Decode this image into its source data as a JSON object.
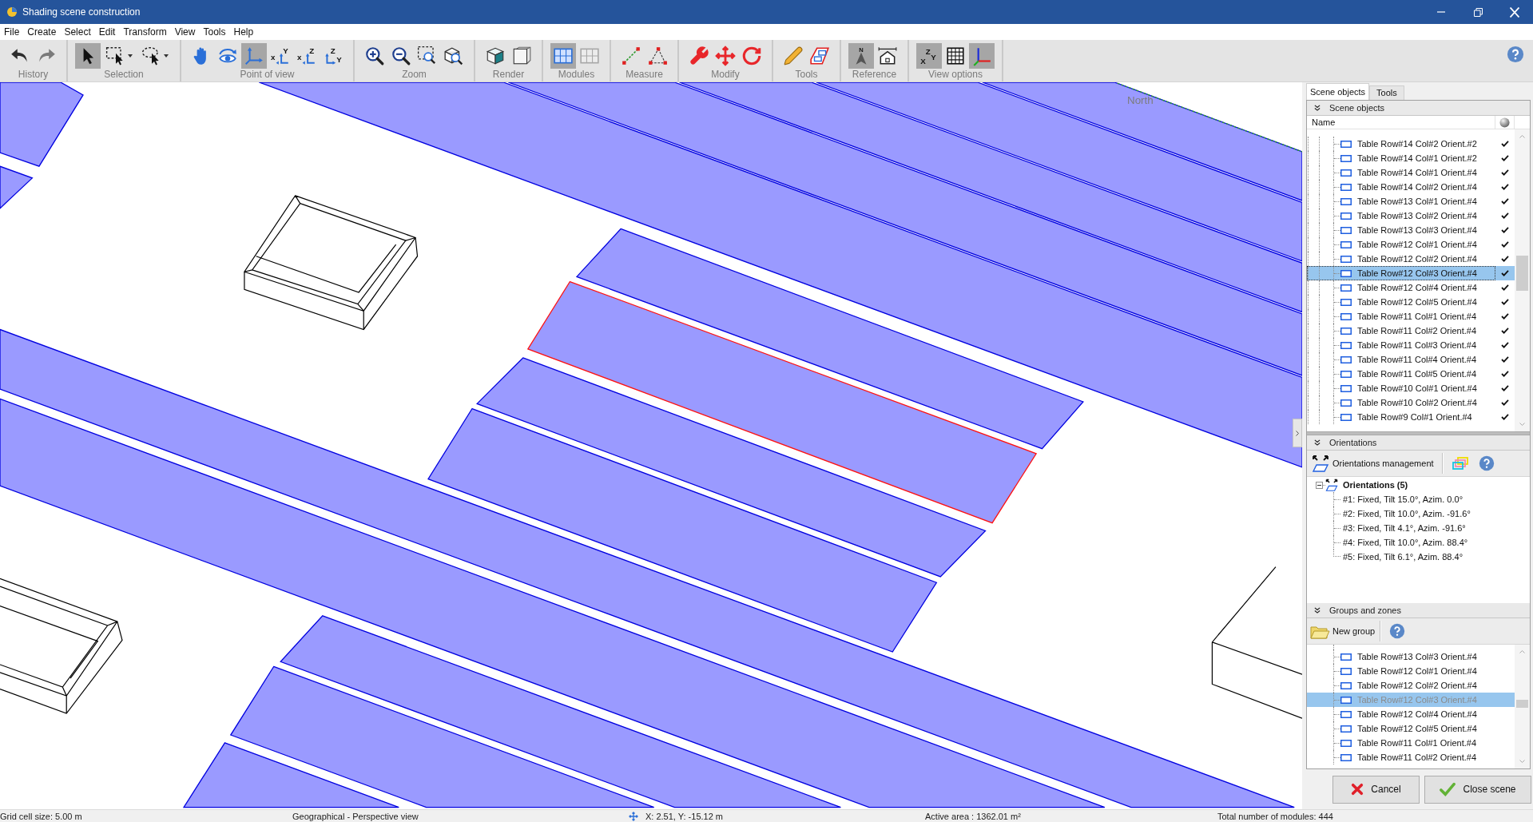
{
  "window": {
    "title": "Shading scene construction"
  },
  "menu": [
    "File",
    "Create",
    "Select",
    "Edit",
    "Transform",
    "View",
    "Tools",
    "Help"
  ],
  "toolbar": {
    "groups": [
      {
        "label": "History",
        "buttons": [
          {
            "kind": "undo",
            "selected": false
          },
          {
            "kind": "redo",
            "selected": false
          }
        ]
      },
      {
        "label": "Selection",
        "buttons": [
          {
            "kind": "pointer",
            "selected": true
          },
          {
            "kind": "rect-select",
            "selected": false,
            "dropdown": true
          },
          {
            "kind": "lasso-select",
            "selected": false,
            "dropdown": true
          }
        ]
      },
      {
        "label": "Point of view",
        "buttons": [
          {
            "kind": "pan",
            "selected": false
          },
          {
            "kind": "orbit",
            "selected": false
          },
          {
            "kind": "axes-view",
            "selected": true
          },
          {
            "kind": "view-xy",
            "selected": false,
            "letters": [
              "x",
              "Y"
            ]
          },
          {
            "kind": "view-xz",
            "selected": false,
            "letters": [
              "x",
              "Z"
            ]
          },
          {
            "kind": "view-zy",
            "selected": false,
            "letters": [
              "Z",
              "Y"
            ]
          }
        ]
      },
      {
        "label": "Zoom",
        "buttons": [
          {
            "kind": "zoom-in",
            "selected": false
          },
          {
            "kind": "zoom-out",
            "selected": false
          },
          {
            "kind": "zoom-window",
            "selected": false
          },
          {
            "kind": "zoom-extents",
            "selected": false
          }
        ]
      },
      {
        "label": "Render",
        "buttons": [
          {
            "kind": "render-solid",
            "selected": false
          },
          {
            "kind": "render-wire",
            "selected": false
          }
        ]
      },
      {
        "label": "Modules",
        "buttons": [
          {
            "kind": "modules-grid",
            "selected": true
          },
          {
            "kind": "modules-table",
            "selected": false
          }
        ]
      },
      {
        "label": "Measure",
        "buttons": [
          {
            "kind": "measure-distance",
            "selected": false
          },
          {
            "kind": "measure-angle",
            "selected": false
          }
        ]
      },
      {
        "label": "Modify",
        "buttons": [
          {
            "kind": "wrench",
            "selected": false
          },
          {
            "kind": "move",
            "selected": false
          },
          {
            "kind": "rotate",
            "selected": false
          }
        ]
      },
      {
        "label": "Tools",
        "buttons": [
          {
            "kind": "pencil",
            "selected": false
          },
          {
            "kind": "shapes",
            "selected": false
          }
        ]
      },
      {
        "label": "Reference",
        "buttons": [
          {
            "kind": "north",
            "selected": true,
            "letters": [
              "N"
            ]
          },
          {
            "kind": "house-width",
            "selected": false
          }
        ]
      },
      {
        "label": "View options",
        "buttons": [
          {
            "kind": "axis-letters",
            "selected": true,
            "letters": [
              "Z",
              "X",
              "Y"
            ]
          },
          {
            "kind": "grid",
            "selected": false
          },
          {
            "kind": "axes-colored",
            "selected": true
          }
        ]
      }
    ]
  },
  "viewport": {
    "compass_label": "North",
    "tables": [
      {
        "selected": false
      },
      {
        "selected": true
      },
      {
        "selected": false
      },
      {
        "selected": false
      }
    ]
  },
  "side_panel": {
    "tabs": [
      {
        "label": "Scene objects",
        "selected": true
      },
      {
        "label": "Tools",
        "selected": false
      }
    ],
    "scene_objects": {
      "title": "Scene objects",
      "column": "Name",
      "rows": [
        {
          "name": "Table Row#14 Col#2 Orient.#2",
          "checked": true,
          "selected": false
        },
        {
          "name": "Table Row#14 Col#1 Orient.#2",
          "checked": true,
          "selected": false
        },
        {
          "name": "Table Row#14 Col#1 Orient.#4",
          "checked": true,
          "selected": false
        },
        {
          "name": "Table Row#14 Col#2 Orient.#4",
          "checked": true,
          "selected": false
        },
        {
          "name": "Table Row#13 Col#1 Orient.#4",
          "checked": true,
          "selected": false
        },
        {
          "name": "Table Row#13 Col#2 Orient.#4",
          "checked": true,
          "selected": false
        },
        {
          "name": "Table Row#13 Col#3 Orient.#4",
          "checked": true,
          "selected": false
        },
        {
          "name": "Table Row#12 Col#1 Orient.#4",
          "checked": true,
          "selected": false
        },
        {
          "name": "Table Row#12 Col#2 Orient.#4",
          "checked": true,
          "selected": false
        },
        {
          "name": "Table Row#12 Col#3 Orient.#4",
          "checked": true,
          "selected": true
        },
        {
          "name": "Table Row#12 Col#4 Orient.#4",
          "checked": true,
          "selected": false
        },
        {
          "name": "Table Row#12 Col#5 Orient.#4",
          "checked": true,
          "selected": false
        },
        {
          "name": "Table Row#11 Col#1 Orient.#4",
          "checked": true,
          "selected": false
        },
        {
          "name": "Table Row#11 Col#2 Orient.#4",
          "checked": true,
          "selected": false
        },
        {
          "name": "Table Row#11 Col#3 Orient.#4",
          "checked": true,
          "selected": false
        },
        {
          "name": "Table Row#11 Col#4 Orient.#4",
          "checked": true,
          "selected": false
        },
        {
          "name": "Table Row#11 Col#5 Orient.#4",
          "checked": true,
          "selected": false
        },
        {
          "name": "Table Row#10 Col#1 Orient.#4",
          "checked": true,
          "selected": false
        },
        {
          "name": "Table Row#10 Col#2 Orient.#4",
          "checked": true,
          "selected": false
        },
        {
          "name": "Table Row#9 Col#1 Orient.#4",
          "checked": true,
          "selected": false
        }
      ]
    },
    "orientations": {
      "title": "Orientations",
      "manage_button": "Orientations management",
      "root": {
        "label": "Orientations (5)",
        "expanded": true,
        "children": [
          {
            "label": "#1: Fixed, Tilt 15.0°, Azim. 0.0°"
          },
          {
            "label": "#2: Fixed, Tilt 10.0°, Azim. -91.6°"
          },
          {
            "label": "#3: Fixed, Tilt 4.1°, Azim. -91.6°"
          },
          {
            "label": "#4: Fixed, Tilt 10.0°, Azim. 88.4°"
          },
          {
            "label": "#5: Fixed, Tilt 6.1°, Azim. 88.4°"
          }
        ]
      }
    },
    "groups": {
      "title": "Groups and zones",
      "new_button": "New group",
      "rows": [
        {
          "name": "Table Row#13 Col#3 Orient.#4",
          "selected": false
        },
        {
          "name": "Table Row#12 Col#1 Orient.#4",
          "selected": false
        },
        {
          "name": "Table Row#12 Col#2 Orient.#4",
          "selected": false
        },
        {
          "name": "Table Row#12 Col#3 Orient.#4",
          "selected": true
        },
        {
          "name": "Table Row#12 Col#4 Orient.#4",
          "selected": false
        },
        {
          "name": "Table Row#12 Col#5 Orient.#4",
          "selected": false
        },
        {
          "name": "Table Row#11 Col#1 Orient.#4",
          "selected": false
        },
        {
          "name": "Table Row#11 Col#2 Orient.#4",
          "selected": false
        }
      ]
    }
  },
  "buttons": [
    {
      "kind": "cancel",
      "label": "Cancel"
    },
    {
      "kind": "confirm",
      "label": "Close scene"
    }
  ],
  "status_bar": [
    {
      "kind": "text",
      "text": "Grid cell size: 5.00 m"
    },
    {
      "kind": "text",
      "text": "Geographical - Perspective view"
    },
    {
      "kind": "coords",
      "text": "X: 2.51, Y: -15.12 m"
    },
    {
      "kind": "text",
      "text": "Active area : 1362.01 m²"
    },
    {
      "kind": "text",
      "text": "Total number of modules: 444"
    }
  ]
}
